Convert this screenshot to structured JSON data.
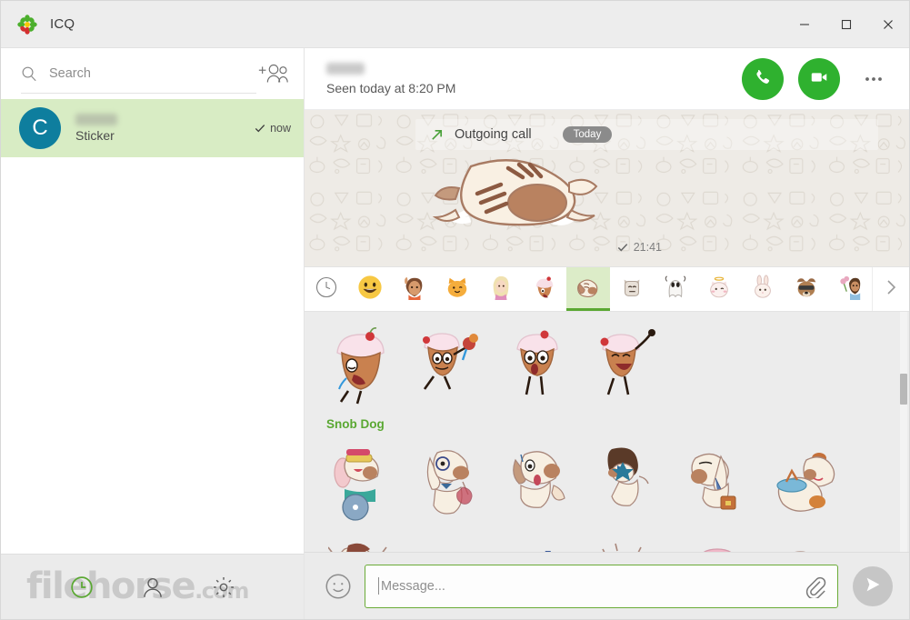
{
  "window": {
    "title": "ICQ",
    "logo_icon": "icq-flower-logo",
    "minimize_label": "─",
    "maximize_label": "□",
    "close_label": "✕"
  },
  "sidebar": {
    "search": {
      "placeholder": "Search",
      "value": "",
      "icon": "search-icon"
    },
    "add_contact_icon": "add-contacts-icon",
    "contacts": [
      {
        "avatar_letter": "C",
        "avatar_color": "#0e7e9e",
        "name": "",
        "preview": "Sticker",
        "status_icon": "check-icon",
        "time": "now",
        "selected": true,
        "selected_color": "#d8ecc4"
      }
    ],
    "bottom_bar": {
      "icons": [
        "history-clock-icon",
        "profile-icon",
        "settings-gear-icon"
      ],
      "clock_color": "#5aa832"
    },
    "watermark": {
      "text": "filehorse",
      "suffix": ".com"
    }
  },
  "chat": {
    "header": {
      "contact_name": "",
      "status": "Seen today at 8:20 PM",
      "call_icon": "phone-icon",
      "video_icon": "video-camera-icon",
      "more_icon": "more-options-icon",
      "action_color": "#2fb12f"
    },
    "events": [
      {
        "icon": "outgoing-call-arrow-icon",
        "label": "Outgoing call",
        "badge": "Today"
      }
    ],
    "messages": [
      {
        "type": "sticker",
        "sticker": "dog-face-down-sticker",
        "time": "21:41",
        "status_icon": "check-icon"
      }
    ]
  },
  "sticker_picker": {
    "tabs": [
      {
        "name": "recent",
        "icon": "clock-icon",
        "active": false
      },
      {
        "name": "emoji",
        "icon": "smiley-emoji",
        "active": false
      },
      {
        "name": "girl-wave",
        "icon": "waving-girl-sticker",
        "active": false
      },
      {
        "name": "cat",
        "icon": "winking-cat-sticker",
        "active": false
      },
      {
        "name": "blonde-girl",
        "icon": "blonde-girl-sticker",
        "active": false
      },
      {
        "name": "cupcake-head",
        "icon": "cupcake-head-sticker",
        "active": false
      },
      {
        "name": "snob-dog",
        "icon": "snob-dog-sticker",
        "active": true
      },
      {
        "name": "grey-cat",
        "icon": "grey-cat-sticker",
        "active": false
      },
      {
        "name": "ghost",
        "icon": "ghost-sticker",
        "active": false
      },
      {
        "name": "angel-cat",
        "icon": "angel-cat-sticker",
        "active": false
      },
      {
        "name": "bunny",
        "icon": "bunny-sticker",
        "active": false
      },
      {
        "name": "cool-dog",
        "icon": "sunglasses-dog-sticker",
        "active": false
      },
      {
        "name": "girl-flowers",
        "icon": "girl-with-flowers-sticker",
        "active": false
      }
    ],
    "next_icon": "chevron-right-icon",
    "active_tab_color": "#5aa832",
    "pack_label": "Snob Dog",
    "pack_label_color": "#5aa832",
    "rows": [
      {
        "pack": "",
        "items": [
          "cupcake-crying",
          "cupcake-flowers",
          "cupcake-shocked",
          "cupcake-laughing"
        ]
      },
      {
        "pack": "Snob Dog",
        "items": [
          "dog-dj",
          "dog-wine",
          "dog-scared",
          "dog-afro",
          "dog-briefcase",
          "dog-feeding"
        ]
      },
      {
        "pack": "",
        "items": [
          "dog-shouting",
          "dog-sleeping",
          "dog-sleepy",
          "dog-surprised",
          "dog-spa",
          "dog-angry"
        ]
      }
    ]
  },
  "composer": {
    "emoji_icon": "smiley-icon",
    "placeholder": "Message...",
    "value": "",
    "attach_icon": "paperclip-icon",
    "send_icon": "send-icon",
    "border_color": "#6aab37",
    "send_color": "#c6c6c6"
  }
}
